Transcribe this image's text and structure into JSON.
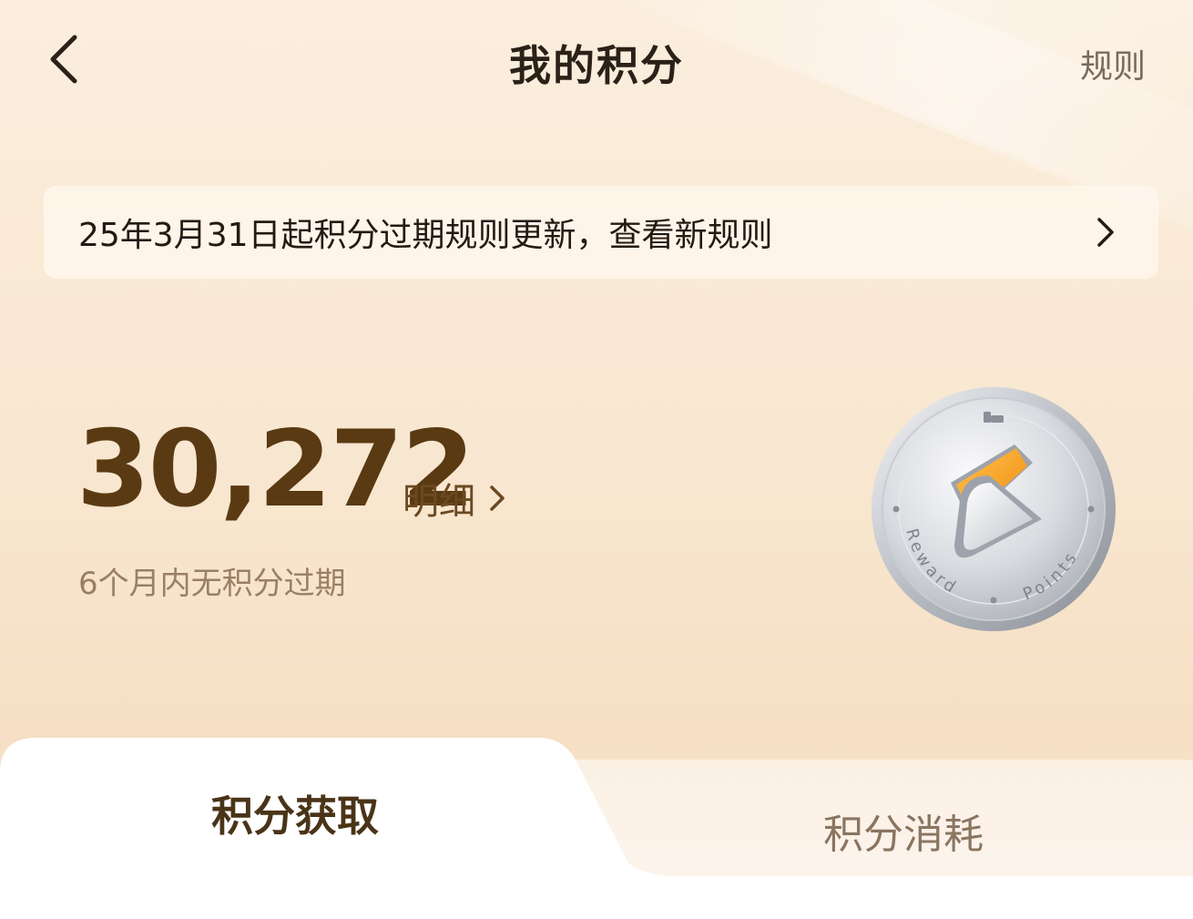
{
  "header": {
    "title": "我的积分",
    "rules_label": "规则",
    "back_icon": "chevron-left-icon"
  },
  "notice": {
    "text": "25年3月31日起积分过期规则更新，查看新规则",
    "chevron_icon": "chevron-right-icon"
  },
  "points": {
    "balance": "30,272",
    "detail_label": "明细",
    "expiry_note": "6个月内无积分过期"
  },
  "coin": {
    "icon": "reward-points-coin-icon",
    "text_left": "Reward",
    "text_right": "Points"
  },
  "tabs": [
    {
      "label": "积分获取",
      "active": true
    },
    {
      "label": "积分消耗",
      "active": false
    }
  ],
  "colors": {
    "accent_brown": "#5a3a12",
    "coin_orange": "#f5a623",
    "background": "#f8e6cf"
  }
}
